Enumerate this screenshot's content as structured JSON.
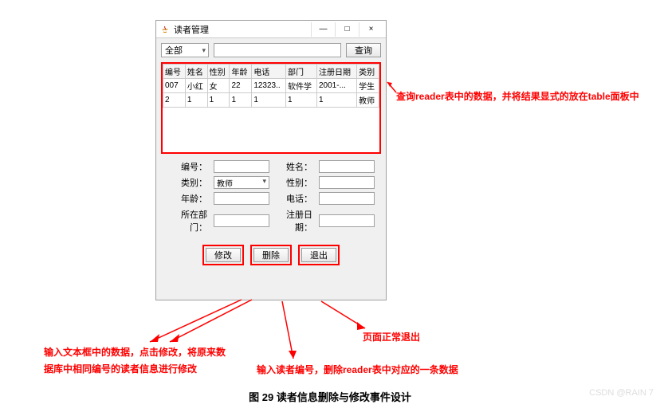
{
  "window": {
    "title": "读者管理",
    "min": "—",
    "max": "□",
    "close": "×"
  },
  "search": {
    "filter_selected": "全部",
    "input_value": "",
    "query_btn": "查询"
  },
  "table": {
    "headers": [
      "编号",
      "姓名",
      "性别",
      "年龄",
      "电话",
      "部门",
      "注册日期",
      "类别"
    ],
    "rows": [
      [
        "007",
        "小红",
        "女",
        "22",
        "12323..",
        "软件学",
        "2001-...",
        "学生"
      ],
      [
        "2",
        "1",
        "1",
        "1",
        "1",
        "1",
        "1",
        "教师"
      ]
    ]
  },
  "form": {
    "id_label": "编号：",
    "name_label": "姓名：",
    "type_label": "类别：",
    "type_value": "教师",
    "gender_label": "性别：",
    "age_label": "年龄：",
    "phone_label": "电话：",
    "dept_label": "所在部门：",
    "regdate_label": "注册日期："
  },
  "actions": {
    "modify": "修改",
    "delete": "删除",
    "exit": "退出"
  },
  "annotations": {
    "query_note": "查询reader表中的数据，并将结果显式的放在table面板中",
    "modify_note_line1": "输入文本框中的数据，点击修改，将原来数",
    "modify_note_line2": "据库中相同编号的读者信息进行修改",
    "delete_note": "输入读者编号，删除reader表中对应的一条数据",
    "exit_note": "页面正常退出"
  },
  "caption": "图 29 读者信息删除与修改事件设计",
  "watermark": "CSDN @RAIN 7"
}
